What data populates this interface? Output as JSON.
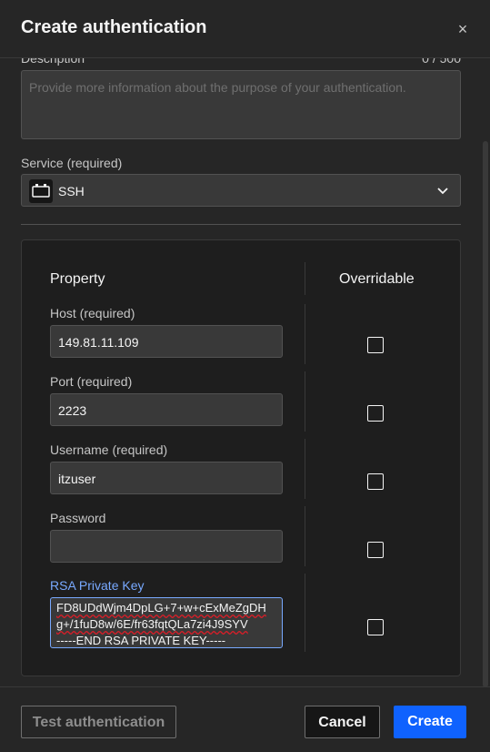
{
  "modal": {
    "title": "Create authentication",
    "close_label": "×"
  },
  "description": {
    "label": "Description",
    "counter": "0 / 500",
    "placeholder": "Provide more information about the purpose of your authentication."
  },
  "service": {
    "label": "Service (required)",
    "value": "SSH",
    "icon": "ssh-terminal-icon"
  },
  "table": {
    "col_property": "Property",
    "col_overridable": "Overridable",
    "fields": [
      {
        "label": "Host (required)",
        "value": "149.81.11.109",
        "overridable": false
      },
      {
        "label": "Port (required)",
        "value": "2223",
        "overridable": false
      },
      {
        "label": "Username (required)",
        "value": "itzuser",
        "overridable": false
      },
      {
        "label": "Password",
        "value": "",
        "overridable": false
      },
      {
        "label": "RSA Private Key",
        "overridable": false,
        "lines": [
          "FD8UDdWjm4DpLG+7+w+cExMeZgDHg+/1fuD8w/6E/fr63fqtQLa7zi4J9SYV",
          "",
          "-----END RSA PRIVATE KEY-----"
        ]
      }
    ]
  },
  "footer": {
    "test_label": "Test authentication",
    "cancel_label": "Cancel",
    "create_label": "Create"
  },
  "colors": {
    "primary": "#0f62fe",
    "focus": "#78a9ff",
    "background": "#262626"
  }
}
